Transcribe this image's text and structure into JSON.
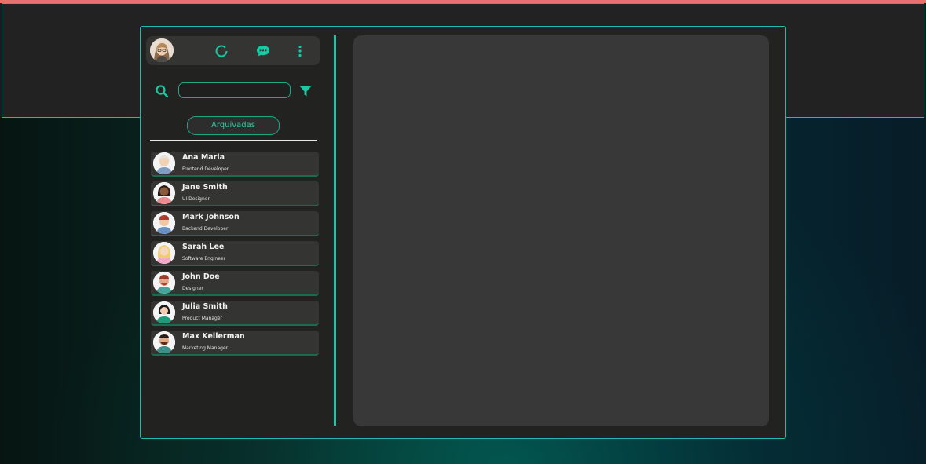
{
  "colors": {
    "accent": "#19c9a4",
    "panel": "#383838",
    "background": "#222221"
  },
  "header": {
    "avatar_icon": "user-avatar",
    "status_icon": "status-ring-icon",
    "chat_icon": "chat-bubble-icon",
    "menu_icon": "more-vertical-icon"
  },
  "search": {
    "placeholder": "",
    "value": "",
    "search_icon": "search-icon",
    "filter_icon": "filter-icon"
  },
  "archived_label": "Arquivadas",
  "contacts": [
    {
      "name": "Ana Maria",
      "role": "Frontend Developer"
    },
    {
      "name": "Jane Smith",
      "role": "UI Designer"
    },
    {
      "name": "Mark Johnson",
      "role": "Backend Developer"
    },
    {
      "name": "Sarah Lee",
      "role": "Software Engineer"
    },
    {
      "name": "John Doe",
      "role": "Designer"
    },
    {
      "name": "Julia Smith",
      "role": "Product Manager"
    },
    {
      "name": "Max Kellerman",
      "role": "Marketing Manager"
    }
  ]
}
